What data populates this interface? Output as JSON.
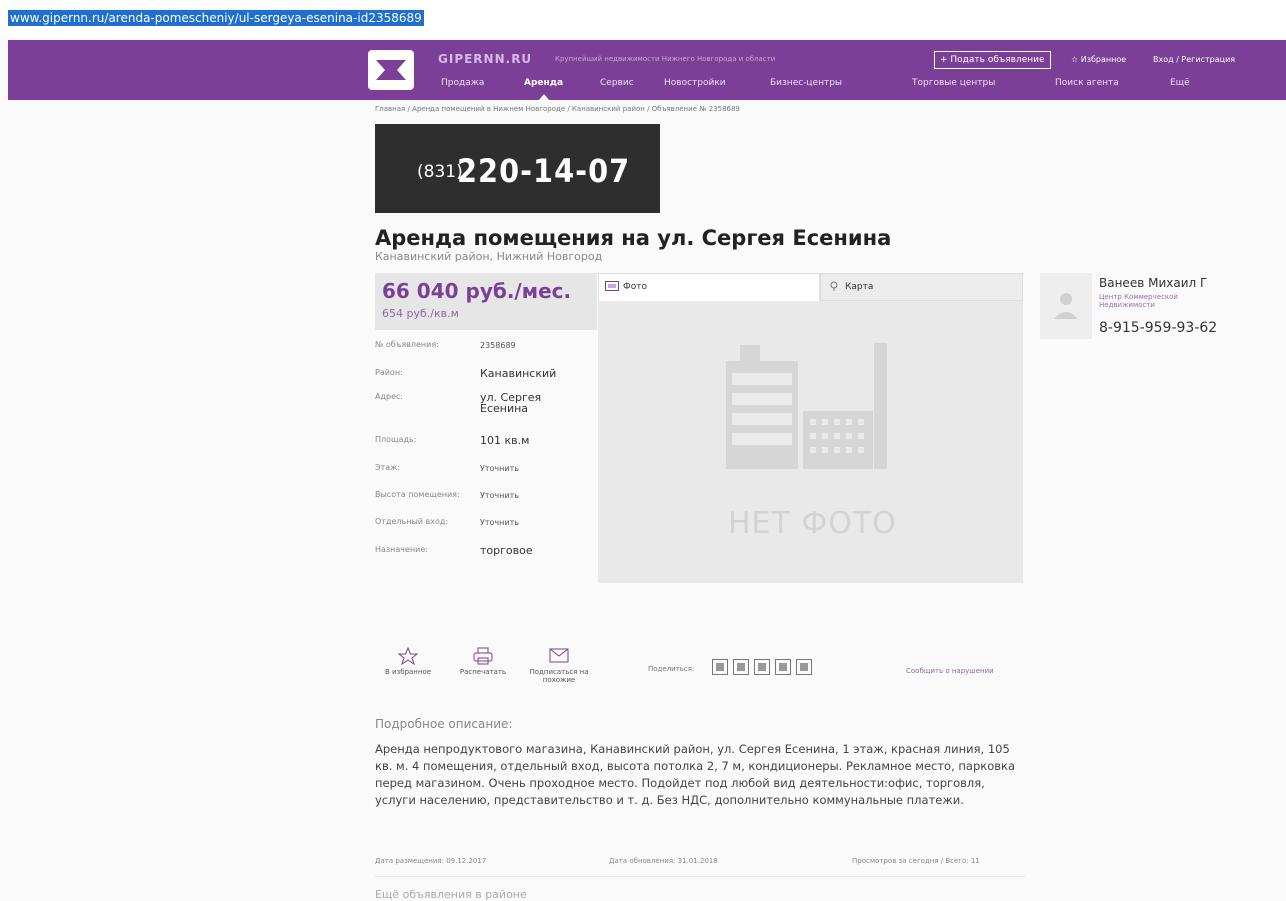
{
  "browser": {
    "url": "www.gipernn.ru/arenda-pomescheniy/ul-sergeya-esenina-id2358689"
  },
  "header": {
    "brand": "GIPERNN.RU",
    "tagline": "Крупнейший недвижимости Нижнего Новгорода и области",
    "add_button": "+ Подать объявление",
    "favorites": "☆ Избранное",
    "login": "Вход / Регистрация",
    "nav": [
      "Продажа",
      "Аренда",
      "Сервис",
      "Новостройки",
      "Бизнес-центры",
      "Торговые центры",
      "Поиск агента",
      "Ещё"
    ],
    "active_nav": "Аренда",
    "brand_color": "#7b3f98"
  },
  "breadcrumb": "Главная / Аренда помещений в Нижнем Новгороде / Канавинский район / Объявление № 2358689",
  "banner": {
    "prefix": "(831)",
    "number": "220-14-07"
  },
  "listing": {
    "title": "Аренда помещения на ул. Сергея Есенина",
    "subtitle": "Канавинский район, Нижний Новгород",
    "price": "66 040 руб./мес.",
    "price_per_sqm": "654 руб./кв.м",
    "props": [
      {
        "key": "№ объявления:",
        "value": "2358689"
      },
      {
        "key": "Район:",
        "value": "Канавинский"
      },
      {
        "key": "Адрес:",
        "value": "ул. Сергея Есенина"
      },
      {
        "key": "Площадь:",
        "value": "101 кв.м"
      },
      {
        "key": "Этаж:",
        "value": "Уточнить"
      },
      {
        "key": "Высота помещения:",
        "value": "Уточнить"
      },
      {
        "key": "Отдельный вход:",
        "value": "Уточнить"
      },
      {
        "key": "Назначение:",
        "value": "торговое"
      }
    ]
  },
  "media": {
    "tab_photo": "Фото",
    "tab_map": "Карта",
    "no_photo": "НЕТ ФОТО"
  },
  "agent": {
    "name": "Ванеев Михаил Г",
    "org": "Центр Коммерческой Недвижимости",
    "phone": "8-915-959-93-62"
  },
  "actions": {
    "favorite": "В избранное",
    "print": "Распечатать",
    "subscribe": "Подписаться на похожие",
    "share_label": "Поделиться:",
    "report": "Сообщить о нарушении"
  },
  "description": {
    "heading": "Подробное описание:",
    "text": "Аренда непродуктового магазина, Канавинский район, ул. Сергея Есенина, 1 этаж, красная линия, 105 кв. м. 4 помещения, отдельный вход, высота потолка 2, 7 м, кондиционеры. Рекламное место, парковка перед магазином. Очень проходное место. Подойдет под любой вид деятельности:офис, торговля, услуги населению, представительство и т. д. Без НДС, дополнительно коммунальные платежи."
  },
  "meta": {
    "posted": "Дата размещения: 09.12.2017",
    "updated": "Дата обновления: 31.01.2018",
    "views": "Просмотров за сегодня / Всего: 11"
  },
  "footer_truncated": "Ещё объявления в районе"
}
